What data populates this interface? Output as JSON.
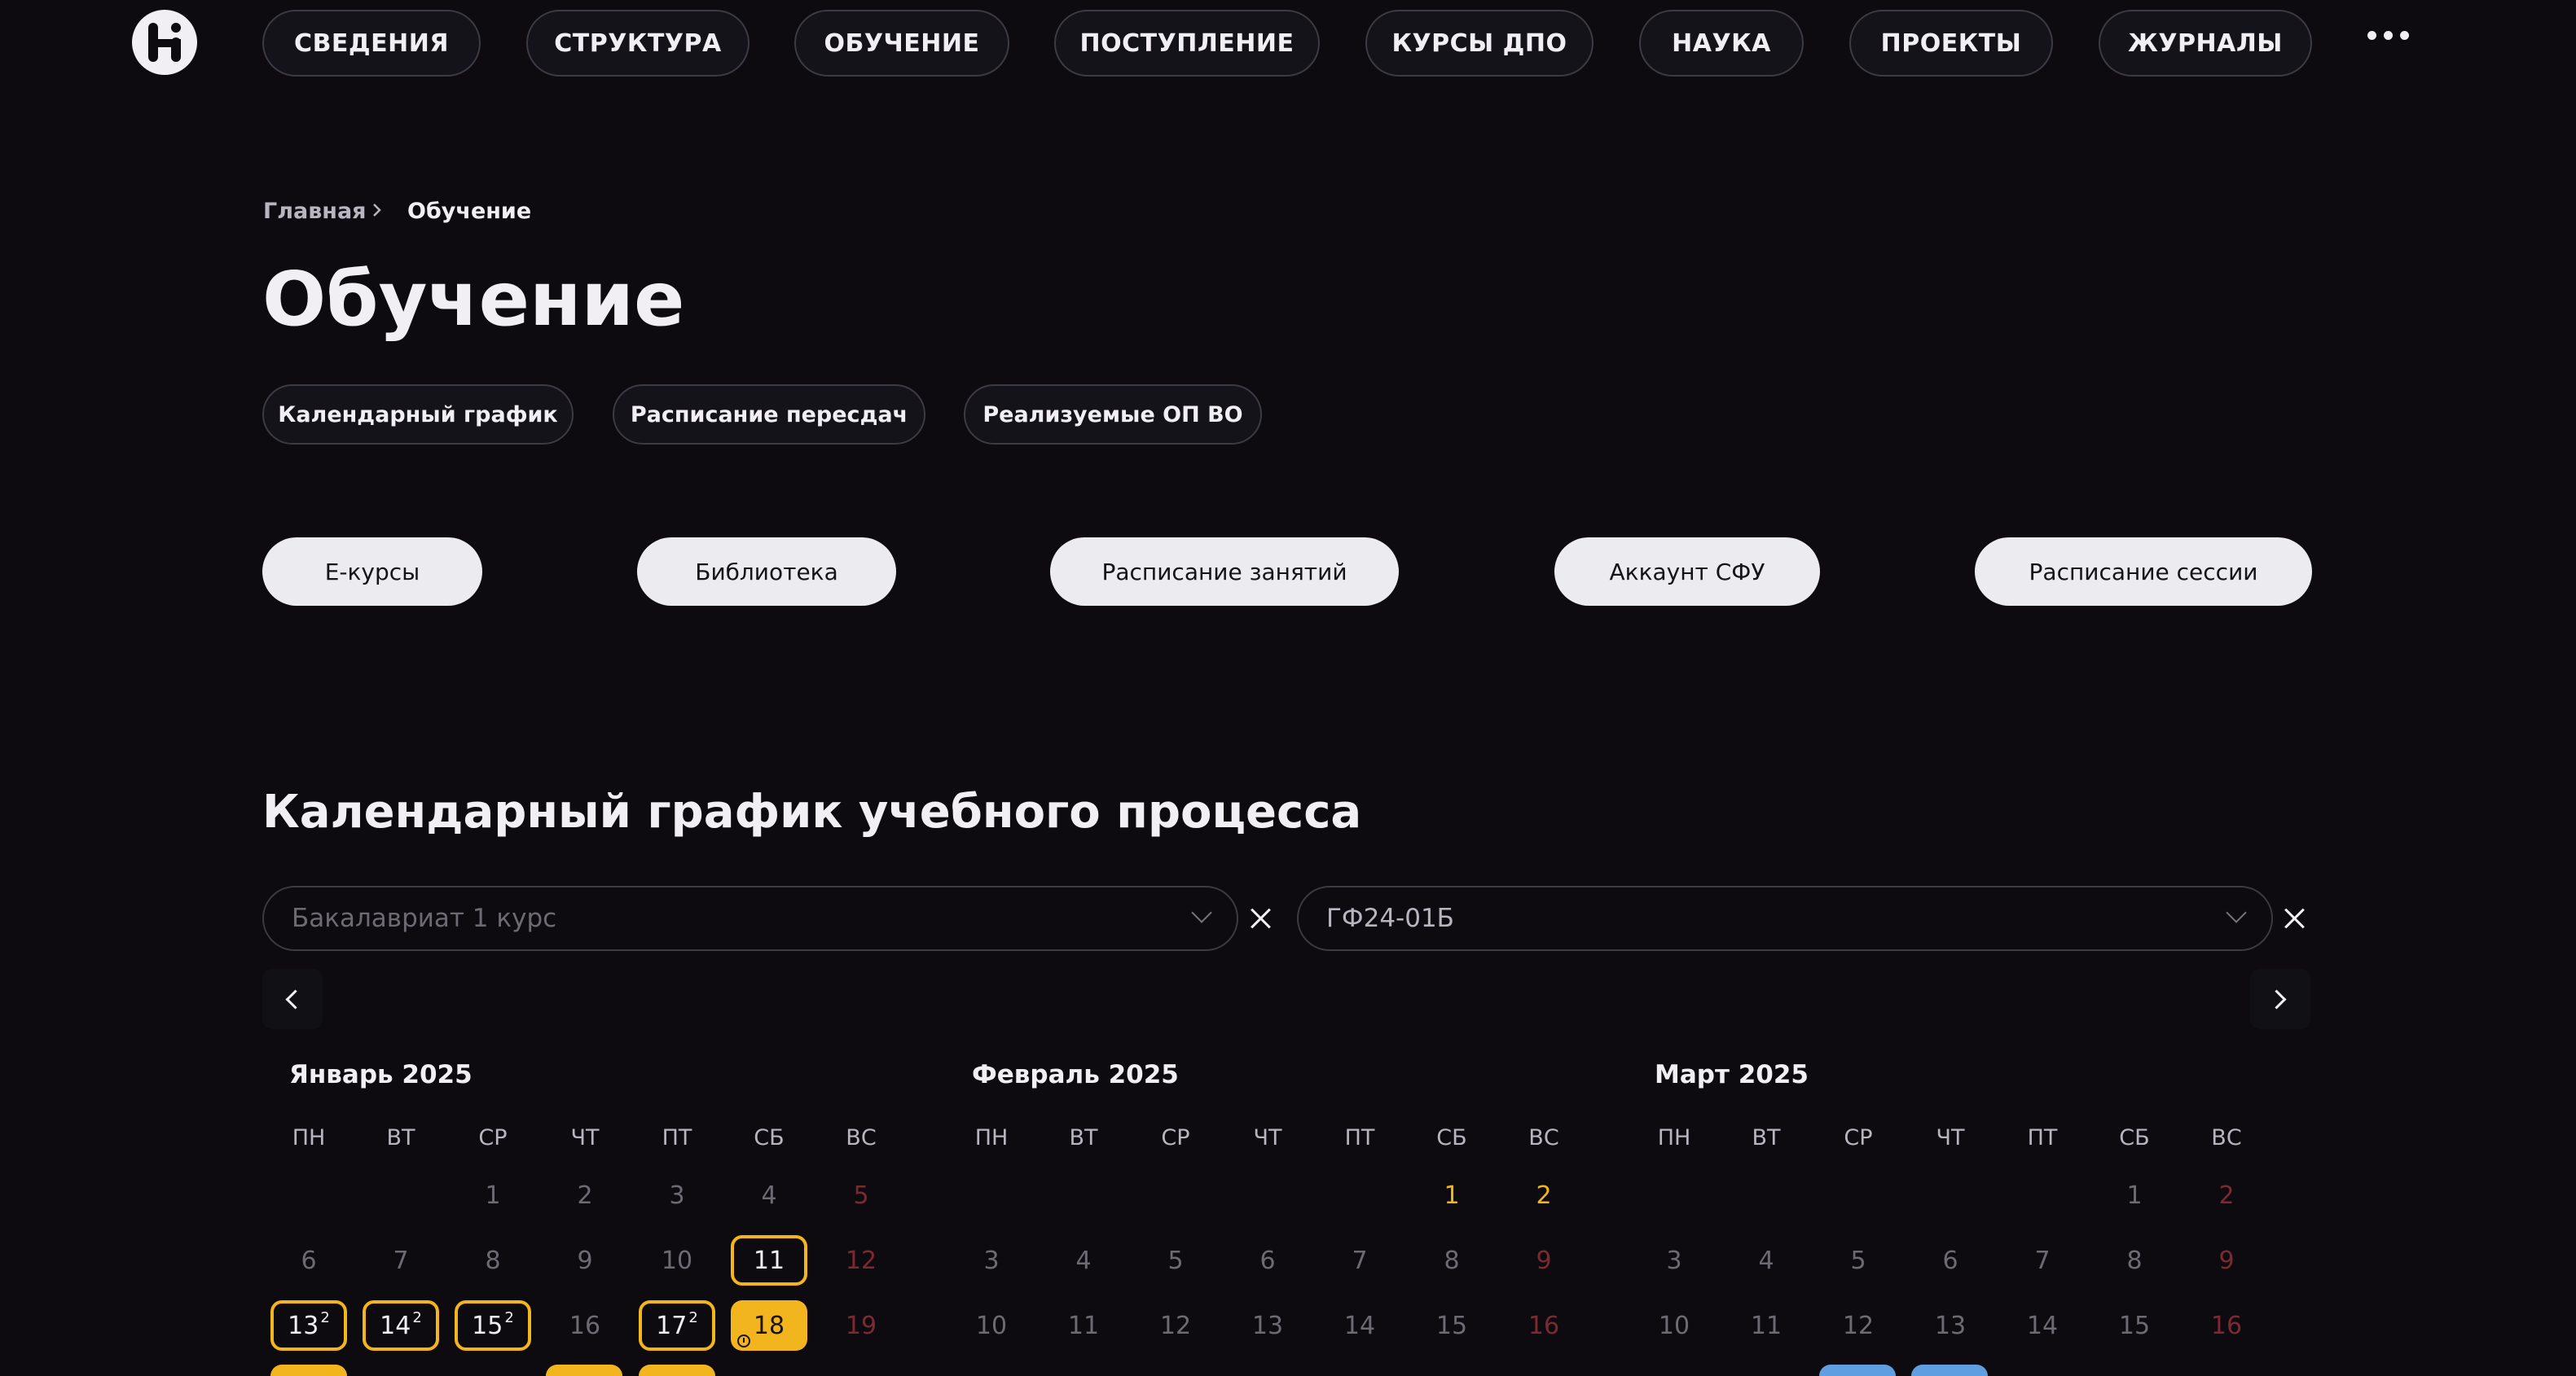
{
  "nav": {
    "items": [
      "СВЕДЕНИЯ",
      "СТРУКТУРА",
      "ОБУЧЕНИЕ",
      "ПОСТУПЛЕНИЕ",
      "КУРСЫ ДПО",
      "НАУКА",
      "ПРОЕКТЫ",
      "ЖУРНАЛЫ"
    ]
  },
  "breadcrumb": {
    "home": "Главная",
    "current": "Обучение"
  },
  "page_title": "Обучение",
  "subnav": [
    "Календарный график",
    "Расписание пересдач",
    "Реализуемые ОП ВО"
  ],
  "quick_links": [
    "Е-курсы",
    "Библиотека",
    "Расписание занятий",
    "Аккаунт СФУ",
    "Расписание сессии"
  ],
  "section_title": "Календарный график учебного процесса",
  "filters": {
    "course_placeholder": "Бакалавриат 1 курс",
    "group_value": "ГФ24-01Б"
  },
  "calendar": {
    "weekdays": [
      "ПН",
      "ВТ",
      "СР",
      "ЧТ",
      "ПТ",
      "СБ",
      "ВС"
    ],
    "months": [
      {
        "title": "Январь 2025",
        "rows": [
          [
            {
              "n": ""
            },
            {
              "n": ""
            },
            {
              "n": "1"
            },
            {
              "n": "2"
            },
            {
              "n": "3"
            },
            {
              "n": "4"
            },
            {
              "n": "5",
              "s": "red"
            }
          ],
          [
            {
              "n": "6"
            },
            {
              "n": "7"
            },
            {
              "n": "8"
            },
            {
              "n": "9"
            },
            {
              "n": "10"
            },
            {
              "n": "11",
              "s": "ring"
            },
            {
              "n": "12",
              "s": "red"
            }
          ],
          [
            {
              "n": "13",
              "s": "ring",
              "sup": "2"
            },
            {
              "n": "14",
              "s": "ring",
              "sup": "2"
            },
            {
              "n": "15",
              "s": "ring",
              "sup": "2"
            },
            {
              "n": "16"
            },
            {
              "n": "17",
              "s": "ring",
              "sup": "2"
            },
            {
              "n": "18",
              "s": "fill",
              "icon": "clock-icon"
            },
            {
              "n": "19",
              "s": "red"
            }
          ]
        ]
      },
      {
        "title": "Февраль 2025",
        "rows": [
          [
            {
              "n": ""
            },
            {
              "n": ""
            },
            {
              "n": ""
            },
            {
              "n": ""
            },
            {
              "n": ""
            },
            {
              "n": "1",
              "s": "orange"
            },
            {
              "n": "2",
              "s": "orange"
            }
          ],
          [
            {
              "n": "3"
            },
            {
              "n": "4"
            },
            {
              "n": "5"
            },
            {
              "n": "6"
            },
            {
              "n": "7"
            },
            {
              "n": "8"
            },
            {
              "n": "9",
              "s": "red"
            }
          ],
          [
            {
              "n": "10"
            },
            {
              "n": "11"
            },
            {
              "n": "12"
            },
            {
              "n": "13"
            },
            {
              "n": "14"
            },
            {
              "n": "15"
            },
            {
              "n": "16",
              "s": "red"
            }
          ]
        ]
      },
      {
        "title": "Март 2025",
        "rows": [
          [
            {
              "n": ""
            },
            {
              "n": ""
            },
            {
              "n": ""
            },
            {
              "n": ""
            },
            {
              "n": ""
            },
            {
              "n": "1"
            },
            {
              "n": "2",
              "s": "red"
            }
          ],
          [
            {
              "n": "3"
            },
            {
              "n": "4"
            },
            {
              "n": "5"
            },
            {
              "n": "6"
            },
            {
              "n": "7"
            },
            {
              "n": "8"
            },
            {
              "n": "9",
              "s": "red"
            }
          ],
          [
            {
              "n": "10"
            },
            {
              "n": "11"
            },
            {
              "n": "12"
            },
            {
              "n": "13"
            },
            {
              "n": "14"
            },
            {
              "n": "15"
            },
            {
              "n": "16",
              "s": "red"
            }
          ]
        ]
      }
    ]
  },
  "colors": {
    "background": "#0d0b0f",
    "accent": "#f3b51d",
    "holiday": "#7a2a30",
    "blue": "#5f9ee0"
  }
}
